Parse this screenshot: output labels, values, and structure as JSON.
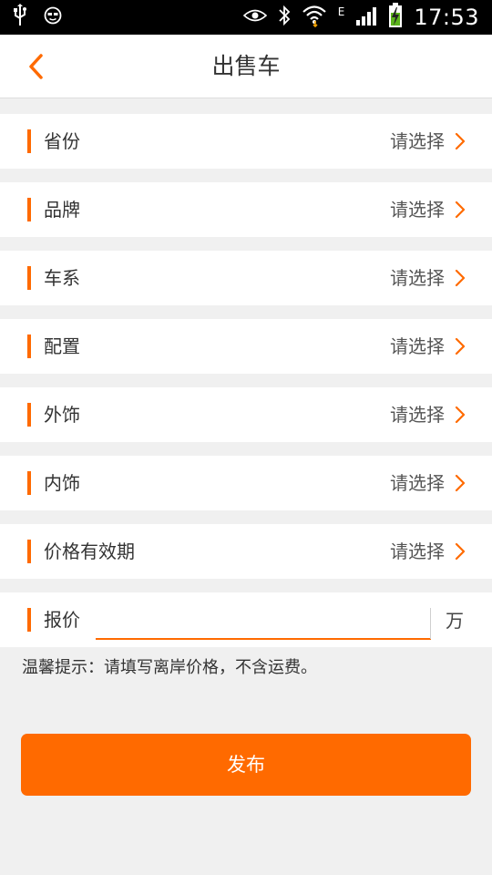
{
  "status_bar": {
    "time": "17:53",
    "network_type": "E",
    "icons": [
      "usb-icon",
      "face-icon",
      "eye-icon",
      "bluetooth-icon",
      "wifi-icon",
      "signal-icon",
      "battery-charging-icon"
    ]
  },
  "header": {
    "back_icon": "chevron-left-icon",
    "title": "出售车"
  },
  "form": {
    "rows": [
      {
        "label": "省份",
        "value": "请选择"
      },
      {
        "label": "品牌",
        "value": "请选择"
      },
      {
        "label": "车系",
        "value": "请选择"
      },
      {
        "label": "配置",
        "value": "请选择"
      },
      {
        "label": "外饰",
        "value": "请选择"
      },
      {
        "label": "内饰",
        "value": "请选择"
      },
      {
        "label": "价格有效期",
        "value": "请选择"
      }
    ],
    "price": {
      "label": "报价",
      "value": "",
      "placeholder": "",
      "unit": "万"
    }
  },
  "tip": "温馨提示：请填写离岸价格，不含运费。",
  "publish_label": "发布",
  "colors": {
    "accent": "#ff6a00",
    "background": "#f0f0f0",
    "status_bar": "#000000"
  }
}
